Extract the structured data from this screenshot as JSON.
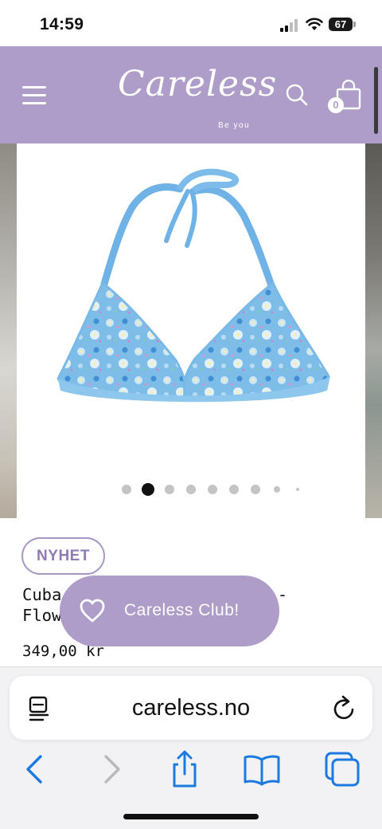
{
  "status_bar": {
    "time": "14:59",
    "battery": "67",
    "icons": [
      "signal-icon",
      "wifi-icon",
      "battery-icon"
    ]
  },
  "header": {
    "logo_text": "Careless",
    "logo_tagline": "Be you",
    "cart_count": "0",
    "brand_color": "#ad9dc8",
    "icons": [
      "menu-icon",
      "search-icon",
      "shopping-bag-icon"
    ]
  },
  "gallery": {
    "image_count": 9,
    "active_index": 1,
    "image_alt": "bikini-top"
  },
  "product": {
    "badge": "NYHET",
    "title": "Cuba Bikini Top - Lyseblå - Flowers",
    "price": "349,00 kr"
  },
  "club_popup": {
    "label": "Careless Club!",
    "icon": "heart-icon"
  },
  "browser": {
    "url": "careless.no",
    "icons": [
      "reader-icon",
      "reload-icon",
      "back-icon",
      "forward-icon",
      "share-icon",
      "bookmarks-icon",
      "tabs-icon"
    ],
    "accent_color": "#1a7ae0"
  }
}
